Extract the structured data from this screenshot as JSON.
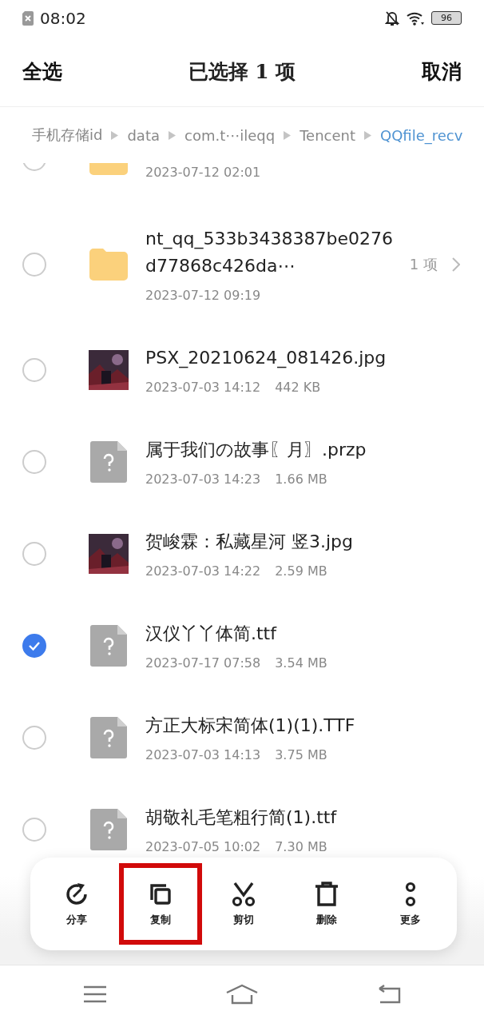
{
  "status_bar": {
    "time": "08:02",
    "battery": "96"
  },
  "header": {
    "select_all": "全选",
    "title": "已选择 1 项",
    "cancel": "取消"
  },
  "breadcrumb": [
    {
      "label": "手机存储id",
      "selected": false
    },
    {
      "label": "data",
      "selected": false
    },
    {
      "label": "com.t⋯ileqq",
      "selected": false
    },
    {
      "label": "Tencent",
      "selected": false
    },
    {
      "label": "QQfile_recv",
      "selected": true
    }
  ],
  "files": [
    {
      "kind": "folder",
      "date": "2023-07-12 02:01",
      "checked": false
    },
    {
      "kind": "folder",
      "name": "nt_qq_533b3438387be0276d77868c426da⋯",
      "date": "2023-07-12 09:19",
      "count": "1 项",
      "checked": false
    },
    {
      "name": "PSX_20210624_081426.jpg",
      "date": "2023-07-03 14:12",
      "size": "442 KB",
      "checked": false
    },
    {
      "kind": "unknown",
      "name": "属于我们の故事〖月〗.przp",
      "date": "2023-07-03 14:23",
      "size": "1.66 MB",
      "checked": false
    },
    {
      "name": "贺峻霖：私藏星河 竖3.jpg",
      "date": "2023-07-03 14:22",
      "size": "2.59 MB",
      "checked": false
    },
    {
      "kind": "unknown",
      "name": "汉仪丫丫体简.ttf",
      "date": "2023-07-17 07:58",
      "size": "3.54 MB",
      "checked": true
    },
    {
      "kind": "unknown",
      "name": "方正大标宋简体(1)(1).TTF",
      "date": "2023-07-03 14:13",
      "size": "3.75 MB",
      "checked": false
    },
    {
      "kind": "unknown",
      "name": "胡敬礼毛笔粗行简(1).ttf",
      "date": "2023-07-05 10:02",
      "size": "7.30 MB",
      "checked": false
    }
  ],
  "actions": [
    {
      "kind": "share",
      "label": "分享",
      "highlighted": false
    },
    {
      "kind": "copy",
      "label": "复制",
      "highlighted": true
    },
    {
      "kind": "cut",
      "label": "剪切",
      "highlighted": false
    },
    {
      "kind": "delete",
      "label": "删除",
      "highlighted": false
    },
    {
      "kind": "more",
      "label": "更多",
      "highlighted": false
    }
  ]
}
